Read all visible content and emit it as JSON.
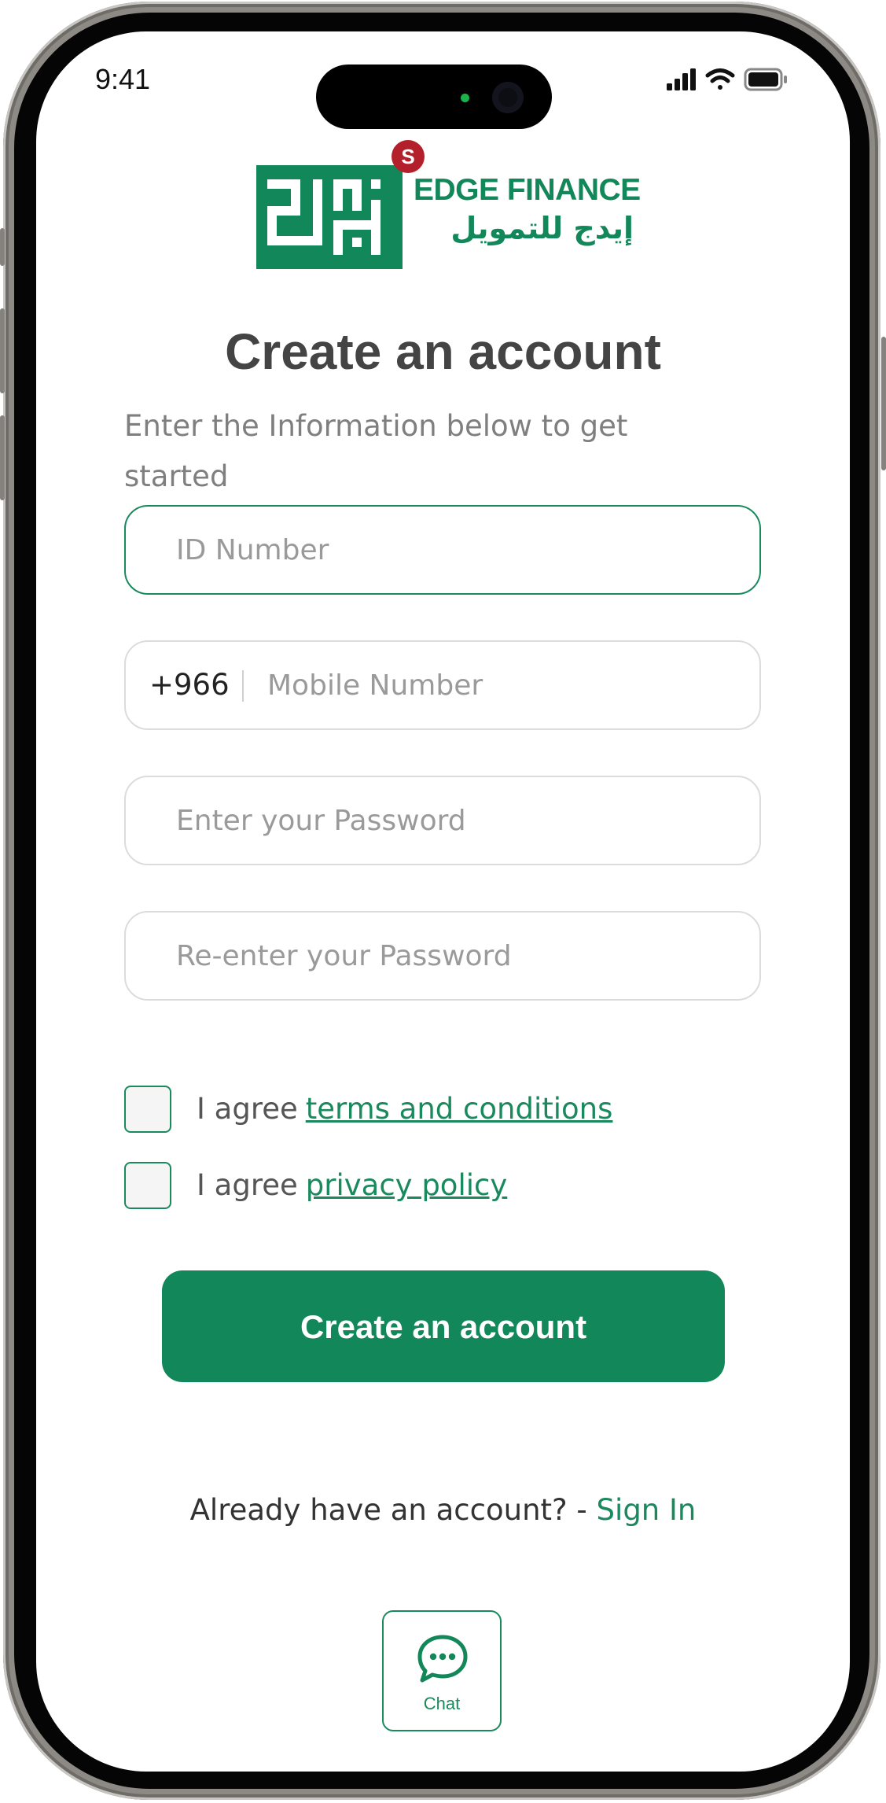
{
  "status_bar": {
    "time": "9:41"
  },
  "brand": {
    "badge": "S",
    "name_en": "EDGE FINANCE",
    "name_ar": "إيدج للتمويل",
    "color": "#12875a"
  },
  "page": {
    "title": "Create an account",
    "subtitle": "Enter the Information below to get started"
  },
  "form": {
    "id_number": {
      "placeholder": "ID Number",
      "value": ""
    },
    "mobile": {
      "prefix": "+966",
      "placeholder": "Mobile Number",
      "value": ""
    },
    "password": {
      "placeholder": "Enter your Password",
      "value": ""
    },
    "confirm_password": {
      "placeholder": "Re-enter your Password",
      "value": ""
    }
  },
  "agreements": {
    "terms": {
      "prefix": "I agree",
      "link": "terms and conditions",
      "checked": false
    },
    "privacy": {
      "prefix": "I agree",
      "link": "privacy policy",
      "checked": false
    }
  },
  "actions": {
    "create_account": "Create an account"
  },
  "signin": {
    "prompt": "Already have an account? -",
    "link": "Sign In"
  },
  "chat": {
    "label": "Chat",
    "icon": "chat-bubble-icon"
  }
}
